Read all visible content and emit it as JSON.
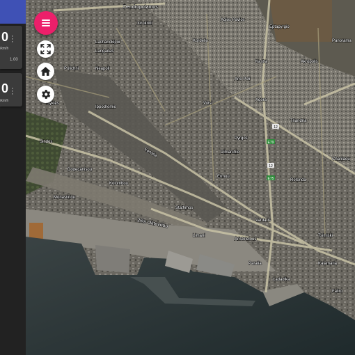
{
  "app": {
    "accent_color": "#ec1f6a",
    "topbar_color": "#3f51b5"
  },
  "sensors": [
    {
      "value": "0",
      "unit": "/km/h",
      "scale": "1.00"
    },
    {
      "value": "0",
      "unit": "/km/h"
    }
  ],
  "controls": {
    "menu_icon": "menu-icon",
    "fullscreen_icon": "fullscreen-icon",
    "home_icon": "home-icon",
    "settings_icon": "gear-icon"
  },
  "map": {
    "labels": [
      "Dendropotamos",
      "Stathmos",
      "26is Oktovriou",
      "Vardaris",
      "Lachanokipoi",
      "Xirokrini",
      "Agios Pavlos",
      "Polichni",
      "Neapoli",
      "Sykies",
      "Triandria",
      "Kalamaria",
      "Ladadika",
      "Limani",
      "Pyrgos",
      "Kastra",
      "Paralia",
      "Charilaou",
      "Votsi",
      "Ano Poli",
      "Rotonda",
      "Ippodromio",
      "Panorama",
      "Faliro",
      "Ermou",
      "Egnatia",
      "Aristotelous",
      "Tsimiski",
      "Monastiriou",
      "Langadas",
      "Kolombou",
      "Dodecanisou",
      "Sindos",
      "Kordelio",
      "Eptapyrgio",
      "Akropolis",
      "Dimarchio",
      "Agora"
    ],
    "road_badges": [
      "12",
      "E79",
      "12",
      "E75"
    ]
  }
}
